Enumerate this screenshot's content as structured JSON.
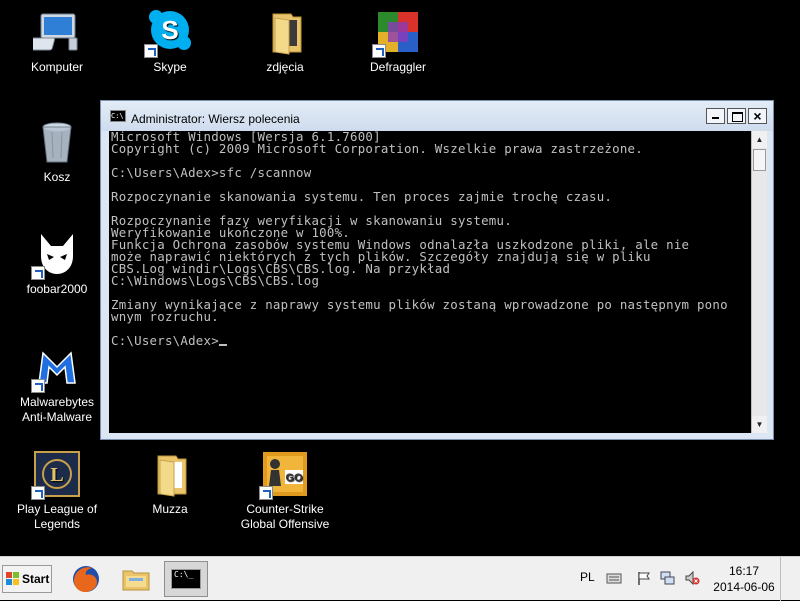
{
  "desktop": {
    "icons": [
      {
        "label": "Komputer",
        "icon": "computer-icon"
      },
      {
        "label": "Skype",
        "icon": "skype-icon"
      },
      {
        "label": "zdjęcia",
        "icon": "folder-icon"
      },
      {
        "label": "Defraggler",
        "icon": "defraggler-icon"
      },
      {
        "label": "Kosz",
        "icon": "recycle-bin-icon"
      },
      {
        "label": "foobar2000",
        "icon": "foobar-icon"
      },
      {
        "label": "Malwarebytes\nAnti-Malware",
        "icon": "malwarebytes-icon"
      },
      {
        "label": "Play League of\nLegends",
        "icon": "league-of-legends-icon"
      },
      {
        "label": "Muzza",
        "icon": "folder-icon"
      },
      {
        "label": "Counter-Strike\nGlobal Offensive",
        "icon": "csgo-icon"
      }
    ]
  },
  "window": {
    "title": "Administrator: Wiersz polecenia",
    "icon_text": "C:\\",
    "console_lines": [
      "Microsoft Windows [Wersja 6.1.7600]",
      "Copyright (c) 2009 Microsoft Corporation. Wszelkie prawa zastrzeżone.",
      "",
      "C:\\Users\\Adex>sfc /scannow",
      "",
      "Rozpoczynanie skanowania systemu. Ten proces zajmie trochę czasu.",
      "",
      "Rozpoczynanie fazy weryfikacji w skanowaniu systemu.",
      "Weryfikowanie ukończone w 100%.",
      "Funkcja Ochrona zasobów systemu Windows odnalazła uszkodzone pliki, ale nie",
      "może naprawić niektórych z tych plików. Szczegóły znajdują się w pliku",
      "CBS.Log windir\\Logs\\CBS\\CBS.log. Na przykład",
      "C:\\Windows\\Logs\\CBS\\CBS.log",
      "",
      "Zmiany wynikające z naprawy systemu plików zostaną wprowadzone po następnym pono",
      "wnym rozruchu.",
      "",
      "C:\\Users\\Adex>"
    ]
  },
  "taskbar": {
    "start_label": "Start",
    "pinned": [
      {
        "name": "firefox-icon"
      },
      {
        "name": "explorer-icon"
      },
      {
        "name": "cmd-icon",
        "text": "C:\\_",
        "active": true
      }
    ],
    "language": "PL",
    "tray_icons": [
      "keyboard-icon",
      "action-center-flag-icon",
      "network-icon",
      "volume-muted-icon"
    ],
    "time": "16:17",
    "date": "2014-06-06"
  },
  "colors": {
    "desktop_bg": "#000000",
    "console_bg": "#000000",
    "console_fg": "#c0c0c0",
    "titlebar": "#d5e2f2",
    "taskbar": "#f0f0f0"
  }
}
